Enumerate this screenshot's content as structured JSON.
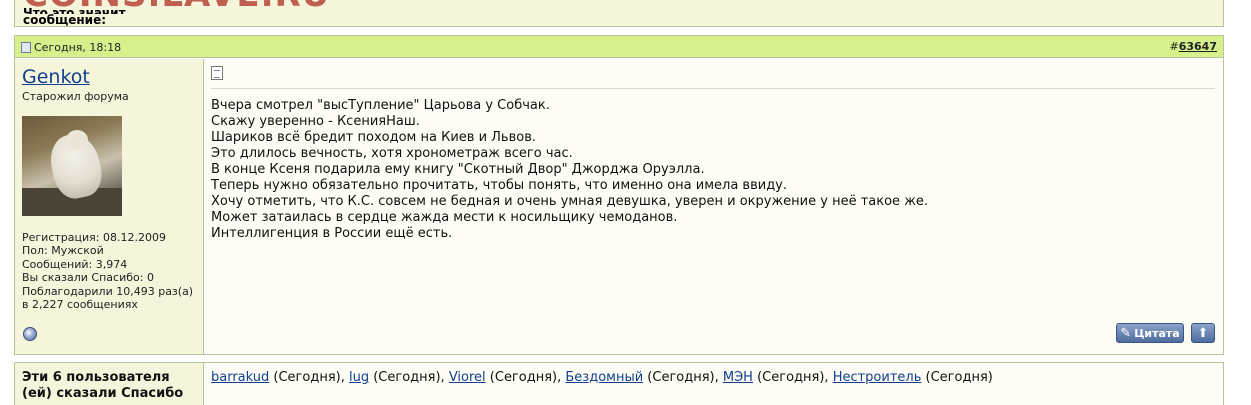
{
  "watermark": "COINS.LAVE.RU",
  "previous_block": {
    "label_line1": "Что это значит",
    "label_line2": "сообщение:"
  },
  "post": {
    "date": "Сегодня, 18:18",
    "number_prefix": "#",
    "number": "63647",
    "username": "Genkot",
    "user_title": "Старожил форума",
    "avatar_icon": "avatar-cat-image",
    "registration": "Регистрация: 08.12.2009",
    "gender": "Пол: Мужской",
    "messages": "Сообщений: 3,974",
    "said_thanks": "Вы сказали Спасибо: 0",
    "thanked": "Поблагодарили 10,493 раз(а)",
    "thanked_in": "в 2,227 сообщениях",
    "body_lines": [
      "Вчера смотрел \"высТупление\" Царьова у Собчак.",
      "Скажу уверенно - КсенияНаш.",
      "Шариков всё бредит походом на Киев и Львов.",
      "Это длилось вечность, хотя хронометраж всего час.",
      "В конце Ксеня подарила ему книгу \"Скотный Двор\" Джорджа Оруэлла.",
      "Теперь нужно обязательно прочитать, чтобы понять, что именно она имела ввиду.",
      "Хочу отметить, что К.С. совсем не бедная и очень умная девушка, уверен и окружение у неё такое же.",
      "Может затаилась в сердце жажда мести к носильщику чемоданов.",
      "Интеллигенция в России ещё есть."
    ],
    "quote_label": "Цитата",
    "top_icon": "arrow-up-icon"
  },
  "thanks": {
    "title_line1": "Эти 6 пользователя",
    "title_line2": "(ей) сказали Спасибо",
    "users": [
      {
        "name": "barrakud",
        "when": " (Сегодня), "
      },
      {
        "name": "lug",
        "when": " (Сегодня), "
      },
      {
        "name": "Viorel",
        "when": " (Сегодня), "
      },
      {
        "name": "Бездомный",
        "when": " (Сегодня), "
      },
      {
        "name": "МЭН",
        "when": " (Сегодня), "
      },
      {
        "name": "Нестроитель",
        "when": " (Сегодня)"
      }
    ]
  },
  "colors": {
    "header_bg": "#d6f08c",
    "panel_bg": "#f5f5dc",
    "link": "#123f8f",
    "border": "#b8c49a"
  }
}
